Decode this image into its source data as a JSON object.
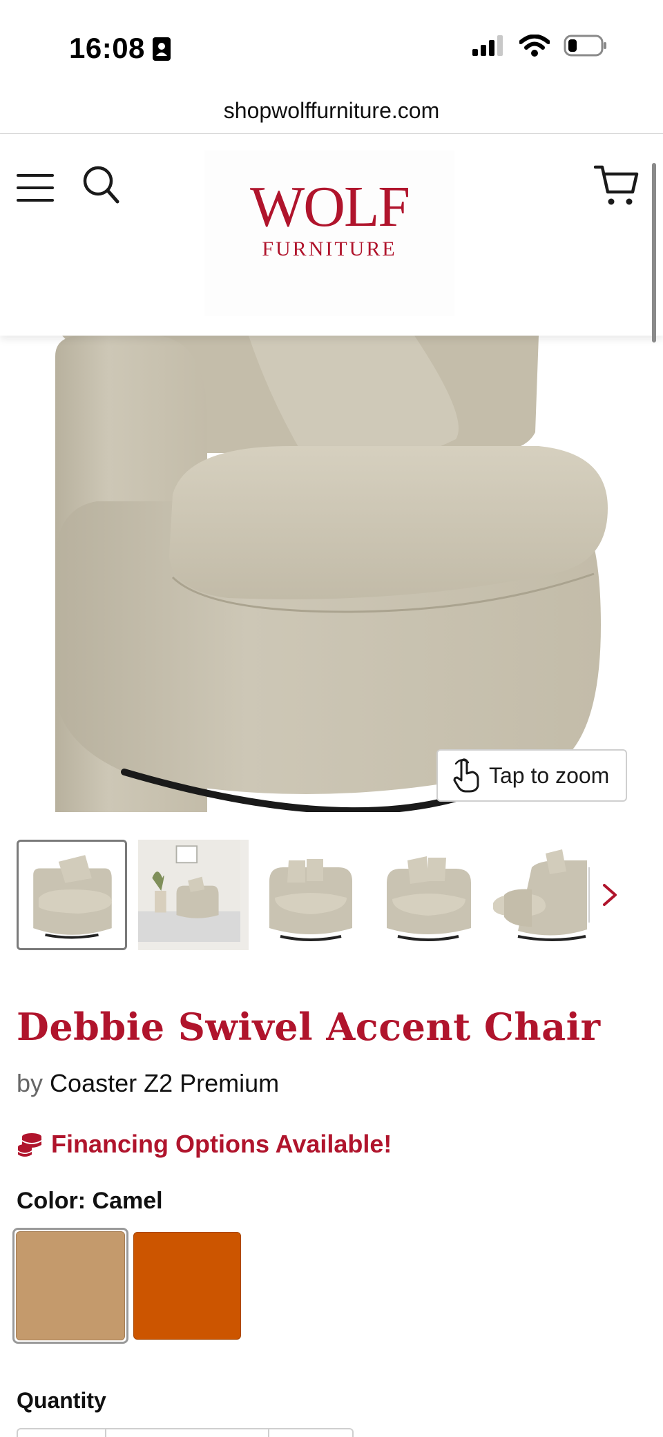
{
  "status_bar": {
    "time": "16:08",
    "id_icon": "contact-card-icon",
    "icons": [
      "cellular-signal-icon",
      "wifi-icon",
      "battery-icon"
    ]
  },
  "browser": {
    "url": "shopwolffurniture.com"
  },
  "header": {
    "menu_icon": "hamburger-menu-icon",
    "search_icon": "search-icon",
    "cart_icon": "cart-icon",
    "logo": {
      "wordmark": "WOLF",
      "subtitle": "FURNITURE",
      "color": "#b0142c"
    }
  },
  "gallery": {
    "zoom_label": "Tap to zoom",
    "zoom_icon": "hand-tap-icon",
    "next_icon": "chevron-right-icon",
    "thumbnail_count": 5,
    "active_thumbnail": 1
  },
  "product": {
    "title": "Debbie Swivel Accent Chair",
    "brand_prefix": "by",
    "brand": "Coaster Z2 Premium",
    "financing": "Financing Options Available!",
    "financing_icon": "coins-icon",
    "color_label": "Color: Camel",
    "swatches": [
      {
        "name": "Camel",
        "color": "#c49a6c",
        "selected": true
      },
      {
        "name": "Orange",
        "color": "#cc5500",
        "selected": false
      }
    ],
    "quantity_label": "Quantity"
  },
  "colors": {
    "brand_red": "#b0142c",
    "fabric": "#c9c3b2"
  }
}
